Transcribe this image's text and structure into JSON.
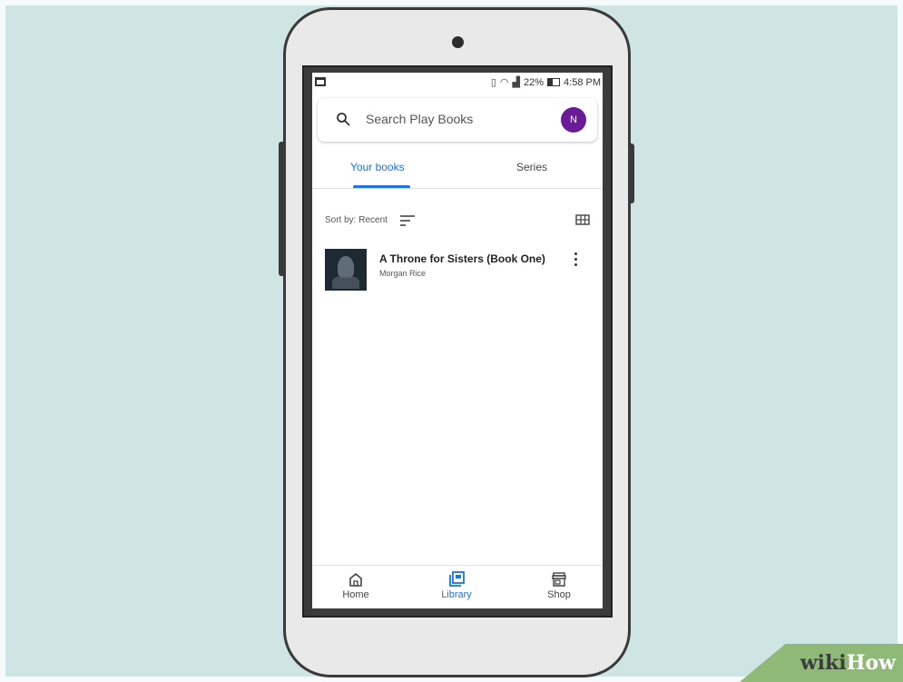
{
  "status_bar": {
    "battery": "22%",
    "time": "4:58 PM"
  },
  "search": {
    "placeholder": "Search Play Books",
    "avatar_initial": "N",
    "avatar_color": "#6a1b9a"
  },
  "tabs": [
    {
      "label": "Your books",
      "active": true
    },
    {
      "label": "Series",
      "active": false
    }
  ],
  "sort": {
    "label": "Sort by: Recent"
  },
  "books": [
    {
      "title": "A Throne for Sisters (Book One)",
      "author": "Morgan Rice"
    }
  ],
  "bottom_nav": [
    {
      "label": "Home",
      "icon": "home-icon",
      "active": false
    },
    {
      "label": "Library",
      "icon": "library-icon",
      "active": true
    },
    {
      "label": "Shop",
      "icon": "shop-icon",
      "active": false
    }
  ],
  "colors": {
    "accent": "#1a73e8",
    "background": "#cfe5e4"
  },
  "watermark": {
    "wiki": "wiki",
    "how": "How"
  }
}
